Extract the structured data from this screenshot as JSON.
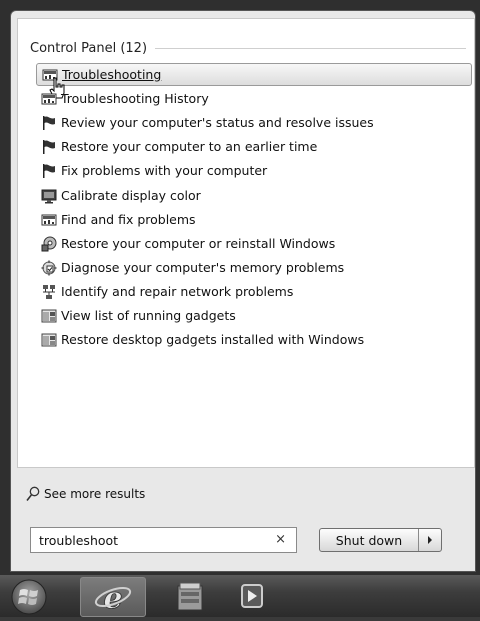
{
  "results": {
    "group_title": "Control Panel (12)",
    "items": [
      {
        "label": "Troubleshooting",
        "icon": "control-panel-icon"
      },
      {
        "label": "Troubleshooting History",
        "icon": "control-panel-icon"
      },
      {
        "label": "Review your computer's status and resolve issues",
        "icon": "flag-icon"
      },
      {
        "label": "Restore your computer to an earlier time",
        "icon": "flag-icon"
      },
      {
        "label": "Fix problems with your computer",
        "icon": "flag-icon"
      },
      {
        "label": "Calibrate display color",
        "icon": "display-icon"
      },
      {
        "label": "Find and fix problems",
        "icon": "control-panel-icon"
      },
      {
        "label": "Restore your computer or reinstall Windows",
        "icon": "recovery-icon"
      },
      {
        "label": "Diagnose your computer's memory problems",
        "icon": "memory-diagnostic-icon"
      },
      {
        "label": "Identify and repair network problems",
        "icon": "network-icon"
      },
      {
        "label": "View list of running gadgets",
        "icon": "gadgets-icon"
      },
      {
        "label": "Restore desktop gadgets installed with Windows",
        "icon": "gadgets-icon"
      }
    ],
    "see_more_label": "See more results"
  },
  "search": {
    "value": "troubleshoot",
    "clear_symbol": "×"
  },
  "shutdown": {
    "label": "Shut down"
  },
  "taskbar": {
    "buttons": [
      {
        "icon": "windows-start-icon"
      },
      {
        "icon": "internet-explorer-icon"
      },
      {
        "icon": "file-explorer-icon"
      },
      {
        "icon": "media-player-icon"
      }
    ]
  },
  "colors": {
    "highlight_border": "#9a9a9a",
    "panel_bg": "#e8e8e8",
    "taskbar": "#3d3d3d"
  }
}
